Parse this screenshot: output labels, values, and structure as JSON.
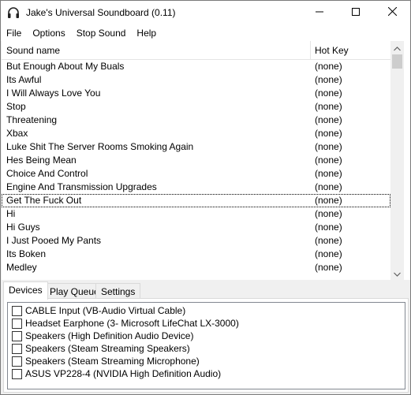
{
  "window": {
    "title": "Jake's Universal Soundboard (0.11)"
  },
  "menu": {
    "items": [
      "File",
      "Options",
      "Stop Sound",
      "Help"
    ]
  },
  "soundlist": {
    "columns": [
      "Sound name",
      "Hot Key"
    ],
    "rows": [
      {
        "name": "But Enough About My Buals",
        "hotkey": "(none)"
      },
      {
        "name": "Its Awful",
        "hotkey": "(none)"
      },
      {
        "name": "I Will Always Love You",
        "hotkey": "(none)"
      },
      {
        "name": "Stop",
        "hotkey": "(none)"
      },
      {
        "name": "Threatening",
        "hotkey": "(none)"
      },
      {
        "name": "Xbax",
        "hotkey": "(none)"
      },
      {
        "name": "Luke Shit The Server Rooms Smoking Again",
        "hotkey": "(none)"
      },
      {
        "name": "Hes Being Mean",
        "hotkey": "(none)"
      },
      {
        "name": "Choice And Control",
        "hotkey": "(none)"
      },
      {
        "name": "Engine And Transmission Upgrades",
        "hotkey": "(none)"
      },
      {
        "name": "Get The Fuck Out",
        "hotkey": "(none)"
      },
      {
        "name": "Hi",
        "hotkey": "(none)"
      },
      {
        "name": "Hi Guys",
        "hotkey": "(none)"
      },
      {
        "name": "I Just Pooed My Pants",
        "hotkey": "(none)"
      },
      {
        "name": "Its Boken",
        "hotkey": "(none)"
      },
      {
        "name": "Medley",
        "hotkey": "(none)"
      }
    ],
    "focused_index": 10
  },
  "tabs": {
    "items": [
      "Devices",
      "Play Queue",
      "Settings"
    ],
    "active": "Devices"
  },
  "devices": [
    {
      "label": "CABLE Input (VB-Audio Virtual Cable)",
      "checked": false
    },
    {
      "label": "Headset Earphone (3- Microsoft LifeChat LX-3000)",
      "checked": false
    },
    {
      "label": "Speakers (High Definition Audio Device)",
      "checked": false
    },
    {
      "label": "Speakers (Steam Streaming Speakers)",
      "checked": false
    },
    {
      "label": "Speakers (Steam Streaming Microphone)",
      "checked": false
    },
    {
      "label": "ASUS VP228-4 (NVIDIA High Definition Audio)",
      "checked": false
    }
  ],
  "icons": {
    "app": "headphones-icon",
    "minimize": "minimize-icon",
    "maximize": "maximize-icon",
    "close": "close-icon"
  }
}
